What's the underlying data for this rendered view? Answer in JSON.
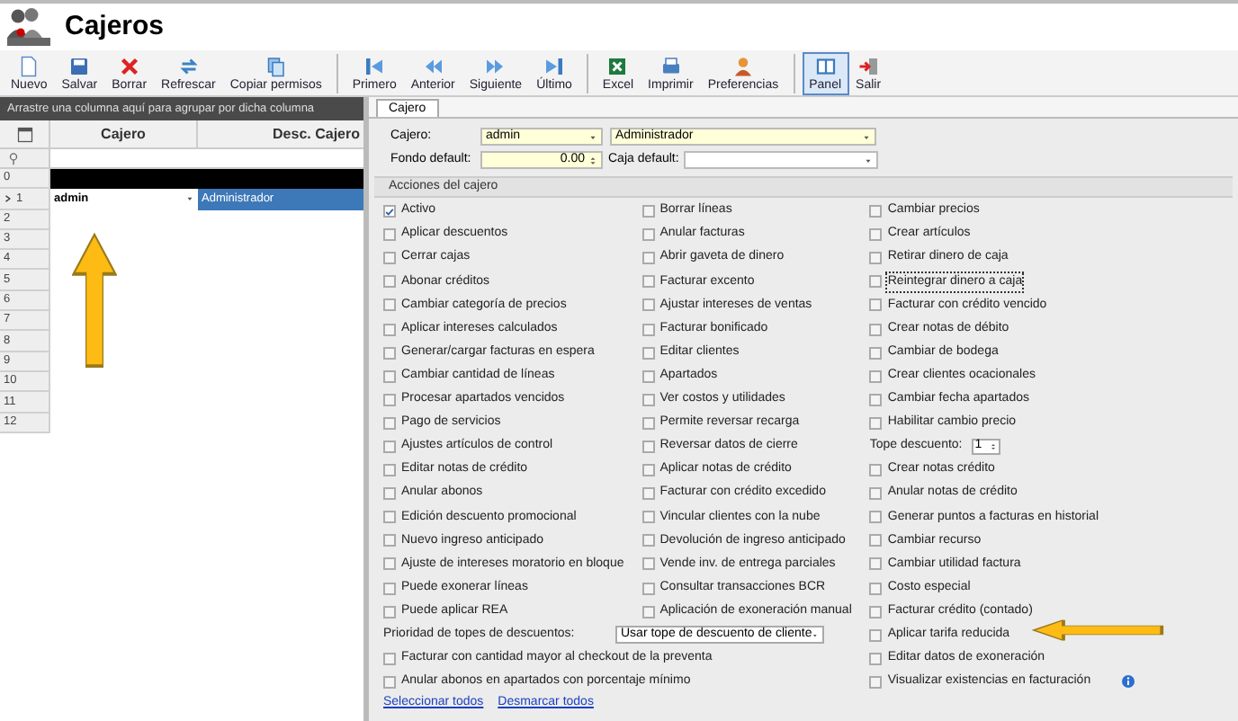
{
  "window": {
    "title": "Cajeros"
  },
  "toolbar": {
    "groups": [
      [
        {
          "label": "Nuevo",
          "selected": false
        },
        {
          "label": "Salvar",
          "selected": false
        },
        {
          "label": "Borrar",
          "selected": false
        },
        {
          "label": "Refrescar",
          "selected": false
        },
        {
          "label": "Copiar permisos",
          "selected": false
        }
      ],
      [
        {
          "label": "Primero",
          "selected": false
        },
        {
          "label": "Anterior",
          "selected": false
        },
        {
          "label": "Siguiente",
          "selected": false
        },
        {
          "label": "Último",
          "selected": false
        }
      ],
      [
        {
          "label": "Excel",
          "selected": false
        },
        {
          "label": "Imprimir",
          "selected": false
        },
        {
          "label": "Preferencias",
          "selected": false
        }
      ],
      [
        {
          "label": "Panel",
          "selected": true
        },
        {
          "label": "Salir",
          "selected": false
        }
      ]
    ]
  },
  "grid": {
    "group_hint": "Arrastre una columna aquí para agrupar por dicha columna",
    "columns": [
      "Cajero",
      "Desc. Cajero"
    ],
    "rows": [
      {
        "number": "0",
        "highlighted": true,
        "current": false
      },
      {
        "number": "1",
        "highlighted": false,
        "current": true,
        "cajero": "admin",
        "desc": "Administrador"
      },
      {
        "number": "2",
        "highlighted": false,
        "current": false
      },
      {
        "number": "3",
        "highlighted": false,
        "current": false
      },
      {
        "number": "4",
        "highlighted": false,
        "current": false
      },
      {
        "number": "5",
        "highlighted": false,
        "current": false
      },
      {
        "number": "6",
        "highlighted": false,
        "current": false
      },
      {
        "number": "7",
        "highlighted": false,
        "current": false
      },
      {
        "number": "8",
        "highlighted": false,
        "current": false
      },
      {
        "number": "9",
        "highlighted": false,
        "current": false
      },
      {
        "number": "10",
        "highlighted": false,
        "current": false
      },
      {
        "number": "11",
        "highlighted": false,
        "current": false
      },
      {
        "number": "12",
        "highlighted": false,
        "current": false
      }
    ]
  },
  "tabs": [
    {
      "label": "Cajero",
      "selected": true
    }
  ],
  "form": {
    "cajero_label": "Cajero:",
    "cajero_value": "admin",
    "desc_value": "Administrador",
    "fondo_label": "Fondo default:",
    "fondo_value": "0.00",
    "caja_label": "Caja default:"
  },
  "actions_title": "Acciones del cajero",
  "actions": [
    [
      {
        "kind": "checkbox",
        "label": "Activo",
        "checked": true
      },
      {
        "kind": "checkbox",
        "label": "Borrar líneas",
        "checked": false
      },
      {
        "kind": "checkbox",
        "label": "Cambiar precios",
        "checked": false
      }
    ],
    [
      {
        "kind": "checkbox",
        "label": "Aplicar descuentos",
        "checked": false
      },
      {
        "kind": "checkbox",
        "label": "Anular facturas",
        "checked": false
      },
      {
        "kind": "checkbox",
        "label": "Crear artículos",
        "checked": false
      }
    ],
    [
      {
        "kind": "checkbox",
        "label": "Cerrar cajas",
        "checked": false
      },
      {
        "kind": "checkbox",
        "label": "Abrir gaveta de dinero",
        "checked": false
      },
      {
        "kind": "checkbox",
        "label": "Retirar dinero de caja",
        "checked": false
      }
    ],
    [
      {
        "kind": "checkbox",
        "label": "Abonar créditos",
        "checked": false
      },
      {
        "kind": "checkbox",
        "label": "Facturar excento",
        "checked": false
      },
      {
        "kind": "checkbox",
        "label": "Reintegrar dinero a caja",
        "checked": false,
        "focused": true
      }
    ],
    [
      {
        "kind": "checkbox",
        "label": "Cambiar categoría de precios",
        "checked": false
      },
      {
        "kind": "checkbox",
        "label": "Ajustar intereses de ventas",
        "checked": false
      },
      {
        "kind": "checkbox",
        "label": "Facturar con crédito vencido",
        "checked": false
      }
    ],
    [
      {
        "kind": "checkbox",
        "label": "Aplicar intereses calculados",
        "checked": false
      },
      {
        "kind": "checkbox",
        "label": "Facturar bonificado",
        "checked": false
      },
      {
        "kind": "checkbox",
        "label": "Crear notas de débito",
        "checked": false
      }
    ],
    [
      {
        "kind": "checkbox",
        "label": "Generar/cargar facturas en espera",
        "checked": false
      },
      {
        "kind": "checkbox",
        "label": "Editar clientes",
        "checked": false
      },
      {
        "kind": "checkbox",
        "label": "Cambiar de bodega",
        "checked": false
      }
    ],
    [
      {
        "kind": "checkbox",
        "label": "Cambiar cantidad de líneas",
        "checked": false
      },
      {
        "kind": "checkbox",
        "label": "Apartados",
        "checked": false
      },
      {
        "kind": "checkbox",
        "label": "Crear clientes ocacionales",
        "checked": false
      }
    ],
    [
      {
        "kind": "checkbox",
        "label": "Procesar apartados vencidos",
        "checked": false
      },
      {
        "kind": "checkbox",
        "label": "Ver costos y utilidades",
        "checked": false
      },
      {
        "kind": "checkbox",
        "label": "Cambiar fecha apartados",
        "checked": false
      }
    ],
    [
      {
        "kind": "checkbox",
        "label": "Pago de servicios",
        "checked": false
      },
      {
        "kind": "checkbox",
        "label": "Permite reversar recarga",
        "checked": false
      },
      {
        "kind": "checkbox",
        "label": "Habilitar cambio precio",
        "checked": false
      }
    ],
    [
      {
        "kind": "checkbox",
        "label": "Ajustes artículos de control",
        "checked": false
      },
      {
        "kind": "checkbox",
        "label": "Reversar datos de cierre",
        "checked": false
      },
      {
        "kind": "spinner",
        "label": "Tope descuento:",
        "value": "1"
      }
    ],
    [
      {
        "kind": "checkbox",
        "label": "Editar notas de crédito",
        "checked": false
      },
      {
        "kind": "checkbox",
        "label": "Aplicar notas de crédito",
        "checked": false
      },
      {
        "kind": "checkbox",
        "label": "Crear notas crédito",
        "checked": false
      }
    ],
    [
      {
        "kind": "checkbox",
        "label": "Anular abonos",
        "checked": false
      },
      {
        "kind": "checkbox",
        "label": "Facturar con crédito excedido",
        "checked": false
      },
      {
        "kind": "checkbox",
        "label": "Anular notas de crédito",
        "checked": false
      }
    ],
    [
      {
        "kind": "checkbox",
        "label": "Edición descuento promocional",
        "checked": false
      },
      {
        "kind": "checkbox",
        "label": "Vincular clientes con la nube",
        "checked": false
      },
      {
        "kind": "checkbox",
        "label": "Generar puntos a facturas en historial",
        "checked": false
      }
    ],
    [
      {
        "kind": "checkbox",
        "label": "Nuevo ingreso anticipado",
        "checked": false
      },
      {
        "kind": "checkbox",
        "label": "Devolución de ingreso anticipado",
        "checked": false
      },
      {
        "kind": "checkbox",
        "label": "Cambiar recurso",
        "checked": false
      }
    ],
    [
      {
        "kind": "checkbox",
        "label": "Ajuste de intereses moratorio en bloque",
        "checked": false
      },
      {
        "kind": "checkbox",
        "label": "Vende inv. de entrega parciales",
        "checked": false
      },
      {
        "kind": "checkbox",
        "label": "Cambiar utilidad factura",
        "checked": false
      }
    ],
    [
      {
        "kind": "checkbox",
        "label": "Puede exonerar líneas",
        "checked": false
      },
      {
        "kind": "checkbox",
        "label": "Consultar transacciones BCR",
        "checked": false
      },
      {
        "kind": "checkbox",
        "label": "Costo especial",
        "checked": false
      }
    ],
    [
      {
        "kind": "checkbox",
        "label": "Puede aplicar REA",
        "checked": false
      },
      {
        "kind": "checkbox",
        "label": "Aplicación de exoneración manual",
        "checked": false
      },
      {
        "kind": "checkbox",
        "label": "Facturar crédito (contado)",
        "checked": false
      }
    ],
    [
      {
        "kind": "select",
        "label": "Prioridad de topes de descuentos:",
        "value": "Usar tope de descuento de cliente"
      },
      {
        "kind": "checkbox",
        "label": "Aplicar tarifa reducida",
        "checked": false
      }
    ],
    [
      {
        "kind": "wide_checkbox",
        "label": "Facturar con cantidad mayor al checkout de la preventa",
        "checked": false
      },
      {
        "kind": "checkbox",
        "label": "Editar datos de exoneración",
        "checked": false
      }
    ],
    [
      {
        "kind": "wide_checkbox",
        "label": "Anular abonos en apartados con porcentaje mínimo",
        "checked": false
      },
      {
        "kind": "info_checkbox",
        "label": "Visualizar existencias en facturación",
        "checked": false
      }
    ]
  ],
  "links": [
    "Seleccionar todos",
    "Desmarcar todos"
  ]
}
